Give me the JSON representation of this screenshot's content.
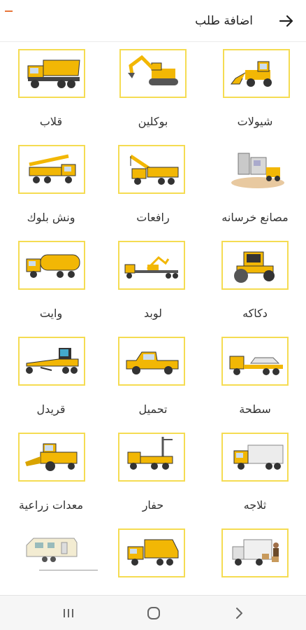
{
  "header": {
    "title": "اضافة طلب",
    "back_icon": "arrow-right-icon",
    "accent_color": "#e8763a"
  },
  "colors": {
    "vehicle_yellow": "#f2b705",
    "thumb_border": "#f5dc52",
    "text": "#333333"
  },
  "categories": [
    {
      "label": "شيولات",
      "icon": "wheel-loader-icon"
    },
    {
      "label": "بوكلين",
      "icon": "excavator-icon"
    },
    {
      "label": "قلاب",
      "icon": "dump-truck-icon"
    },
    {
      "label": "مصانع خرسانه",
      "icon": "concrete-plant-icon"
    },
    {
      "label": "رافعات",
      "icon": "crane-truck-icon"
    },
    {
      "label": "ونش بلوك",
      "icon": "block-winch-icon"
    },
    {
      "label": "دكاكه",
      "icon": "road-roller-icon"
    },
    {
      "label": "لوبد",
      "icon": "lowbed-trailer-icon"
    },
    {
      "label": "وايت",
      "icon": "water-tanker-icon"
    },
    {
      "label": "سطحة",
      "icon": "flatbed-tow-truck-icon"
    },
    {
      "label": "تحميل",
      "icon": "pickup-truck-icon"
    },
    {
      "label": "قريدل",
      "icon": "motor-grader-icon"
    },
    {
      "label": "ثلاجه",
      "icon": "refrigerated-truck-icon"
    },
    {
      "label": "حفار",
      "icon": "drilling-rig-icon"
    },
    {
      "label": "معدات زراعية",
      "icon": "harvester-icon"
    },
    {
      "label": "",
      "icon": "moving-truck-icon"
    },
    {
      "label": "",
      "icon": "roll-off-truck-icon"
    },
    {
      "label": "",
      "icon": "caravan-icon"
    }
  ],
  "bottom_nav": {
    "recents_icon": "recent-apps-icon",
    "home_icon": "home-icon",
    "back_icon": "nav-back-icon"
  }
}
